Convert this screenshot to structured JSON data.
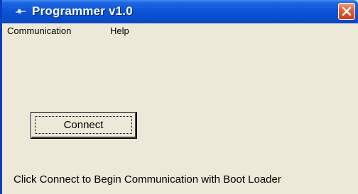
{
  "window": {
    "title": "Programmer v1.0",
    "colors": {
      "titlebar": "#0a4fd0",
      "client": "#ece9d8",
      "close": "#e2623a"
    }
  },
  "menu": {
    "items": [
      {
        "label": "Communication"
      },
      {
        "label": "Help"
      }
    ]
  },
  "main": {
    "connect_label": "Connect",
    "status": "Click Connect to Begin Communication with Boot Loader"
  },
  "icons": {
    "app": "app-icon",
    "close": "close-icon"
  }
}
